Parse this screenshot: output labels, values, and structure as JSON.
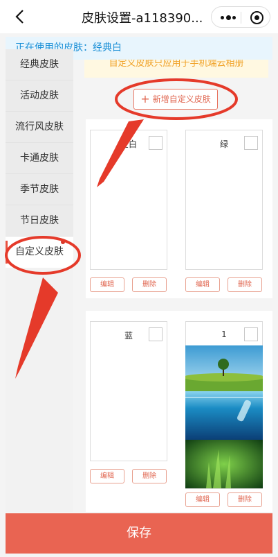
{
  "navbar": {
    "title": "皮肤设置-a118390..."
  },
  "current_skin": {
    "label": "正在使用的皮肤：",
    "value": "经典白"
  },
  "sidebar": {
    "items": [
      {
        "label": "经典皮肤"
      },
      {
        "label": "活动皮肤"
      },
      {
        "label": "流行风皮肤"
      },
      {
        "label": "卡通皮肤"
      },
      {
        "label": "季节皮肤"
      },
      {
        "label": "节日皮肤"
      },
      {
        "label": "自定义皮肤"
      }
    ]
  },
  "notice": "自定义皮肤只应用于手机端云相册",
  "add_button": {
    "label": "新增自定义皮肤"
  },
  "cards": [
    {
      "label": "空白",
      "edit": "编辑",
      "delete": "删除"
    },
    {
      "label": "绿",
      "edit": "编辑",
      "delete": "删除"
    },
    {
      "label": "蓝",
      "edit": "编辑",
      "delete": "删除"
    },
    {
      "label": "1",
      "edit": "编辑",
      "delete": "删除"
    }
  ],
  "save_button": {
    "label": "保存"
  },
  "colors": {
    "accent": "#e96452",
    "annotation": "#e53a2a",
    "info_bg": "#e8f5fd",
    "info_text": "#1a8fd6"
  }
}
